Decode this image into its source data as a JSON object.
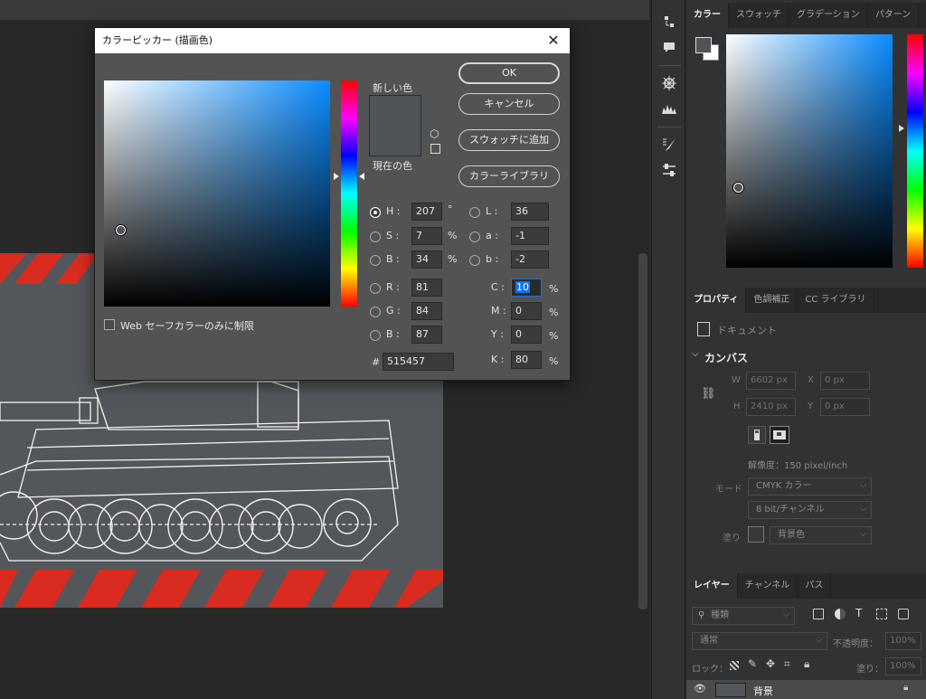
{
  "dialog": {
    "title": "カラーピッカー (描画色)",
    "new_color_label": "新しい色",
    "current_color_label": "現在の色",
    "web_safe_label": "Web セーフカラーのみに制限",
    "buttons": {
      "ok": "OK",
      "cancel": "キャンセル",
      "add_swatch": "スウォッチに追加",
      "color_libraries": "カラーライブラリ"
    },
    "fields": {
      "H": {
        "label": "H :",
        "value": "207",
        "unit": "°"
      },
      "S": {
        "label": "S :",
        "value": "7",
        "unit": "%"
      },
      "B": {
        "label": "B :",
        "value": "34",
        "unit": "%"
      },
      "R": {
        "label": "R :",
        "value": "81"
      },
      "G": {
        "label": "G :",
        "value": "84"
      },
      "Bl": {
        "label": "B :",
        "value": "87"
      },
      "L": {
        "label": "L :",
        "value": "36"
      },
      "a": {
        "label": "a :",
        "value": "-1"
      },
      "b": {
        "label": "b :",
        "value": "-2"
      },
      "C": {
        "label": "C :",
        "value": "10",
        "unit": "%"
      },
      "M": {
        "label": "M :",
        "value": "0",
        "unit": "%"
      },
      "Y": {
        "label": "Y :",
        "value": "0",
        "unit": "%"
      },
      "K": {
        "label": "K :",
        "value": "80",
        "unit": "%"
      },
      "hex": {
        "label": "#",
        "value": "515457"
      }
    },
    "current_color": "#515457"
  },
  "color_panel": {
    "tabs": [
      "カラー",
      "スウォッチ",
      "グラデーション",
      "パターン"
    ]
  },
  "properties": {
    "tabs": [
      "プロパティ",
      "色調補正",
      "CC ライブラリ"
    ],
    "doc_label": "ドキュメント",
    "canvas_section": "カンバス",
    "w_label": "W",
    "w_value": "6602 px",
    "x_label": "X",
    "x_value": "0 px",
    "h_label": "H",
    "h_value": "2410 px",
    "y_label": "Y",
    "y_value": "0 px",
    "resolution": "解像度：150 pixel/inch",
    "mode_label": "モード",
    "mode_value": "CMYK カラー",
    "depth_value": "8 bit/チャンネル",
    "fill_label": "塗り",
    "fill_value": "背景色"
  },
  "layers": {
    "tabs": [
      "レイヤー",
      "チャンネル",
      "パス"
    ],
    "filter_value": "種類",
    "blend_value": "通常",
    "opacity_label": "不透明度：",
    "opacity_value": "100%",
    "lock_label": "ロック：",
    "fill_label": "塗り：",
    "fill_value": "100%",
    "layer_name": "背景"
  },
  "colors": {
    "accent": "#0a8cff",
    "stripe": "#d92b1f",
    "dialog_bg": "#535353"
  }
}
